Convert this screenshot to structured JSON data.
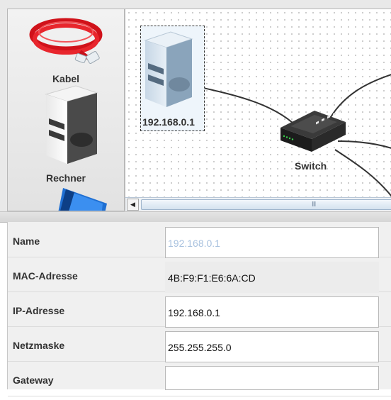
{
  "palette": {
    "items": [
      {
        "label": "Kabel",
        "icon": "ethernet-cable-icon"
      },
      {
        "label": "Rechner",
        "icon": "computer-icon"
      },
      {
        "label": "",
        "icon": "monitor-icon"
      }
    ]
  },
  "canvas": {
    "nodes": {
      "computer": {
        "label": "192.168.0.1",
        "icon": "computer-icon",
        "selected": true
      },
      "switch": {
        "label": "Switch",
        "icon": "switch-icon"
      }
    },
    "scrollbar_grip": "III"
  },
  "properties": {
    "rows": [
      {
        "label": "Name",
        "value": "192.168.0.1",
        "state": "disabled"
      },
      {
        "label": "MAC-Adresse",
        "value": "4B:F9:F1:E6:6A:CD",
        "state": "readonly"
      },
      {
        "label": "IP-Adresse",
        "value": "192.168.0.1",
        "state": "editable"
      },
      {
        "label": "Netzmaske",
        "value": "255.255.255.0",
        "state": "editable"
      },
      {
        "label": "Gateway",
        "value": "",
        "state": "editable"
      }
    ]
  },
  "colors": {
    "accent": "#2f7fd6",
    "cable": "#e0151c",
    "link": "#333333"
  }
}
